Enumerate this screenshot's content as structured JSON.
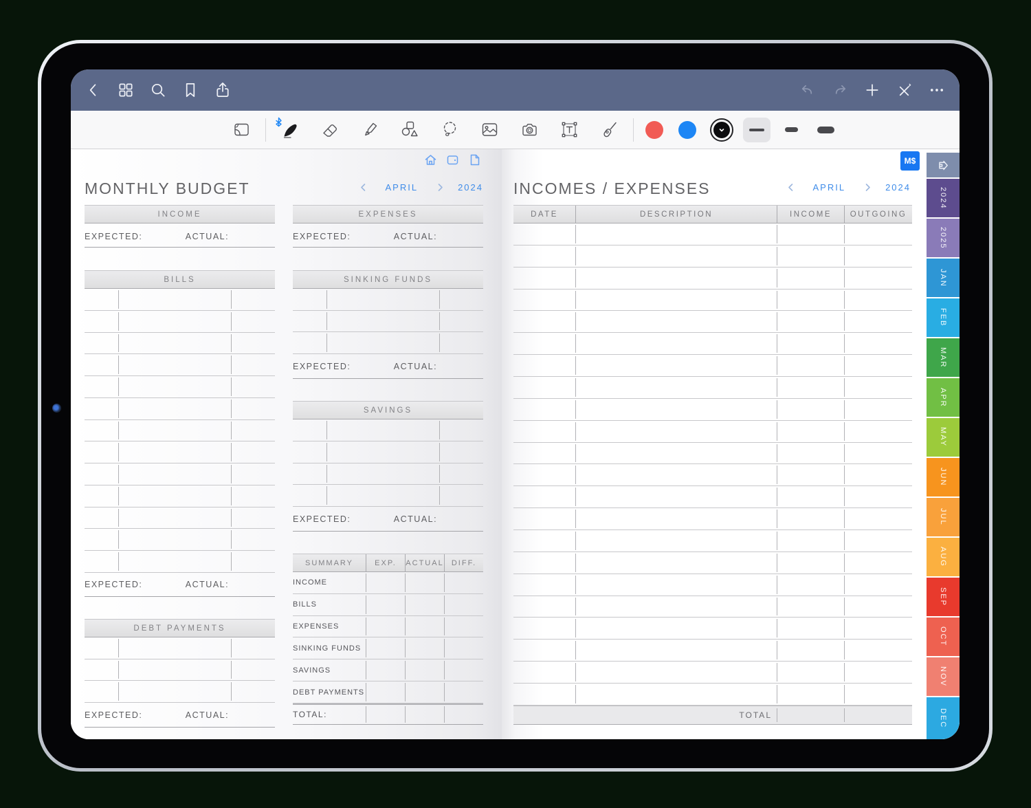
{
  "navbar": {
    "left_icons": [
      "back-icon",
      "grid-icon",
      "search-icon",
      "bookmark-icon",
      "share-icon"
    ],
    "right_icons": [
      "undo-icon",
      "redo-icon",
      "add-page-icon",
      "close-pen-icon",
      "more-icon"
    ]
  },
  "toolbar": {
    "tools": [
      "page-turn",
      "pen",
      "eraser",
      "highlighter",
      "shapes",
      "lasso",
      "image",
      "camera",
      "text-box",
      "laser-pointer"
    ],
    "selected_tool": "pen",
    "colors": [
      "#f15b55",
      "#1d86f5",
      "#0c0c0e"
    ],
    "selected_color": "#0c0c0e",
    "stroke_widths": [
      "thin",
      "medium",
      "thick"
    ],
    "selected_stroke": "thin"
  },
  "page_links": [
    "home-icon",
    "wallet-icon",
    "document-icon"
  ],
  "badge_label": "M$",
  "left_page": {
    "title": "MONTHLY BUDGET",
    "nav": {
      "month": "APRIL",
      "year": "2024"
    },
    "income": {
      "title": "INCOME",
      "expected_label": "EXPECTED:",
      "actual_label": "ACTUAL:"
    },
    "bills": {
      "title": "BILLS",
      "row_count": 13,
      "expected_label": "EXPECTED:",
      "actual_label": "ACTUAL:"
    },
    "debt_payments": {
      "title": "DEBT PAYMENTS",
      "row_count": 3,
      "expected_label": "EXPECTED:",
      "actual_label": "ACTUAL:"
    },
    "expenses": {
      "title": "EXPENSES",
      "expected_label": "EXPECTED:",
      "actual_label": "ACTUAL:"
    },
    "sinking_funds": {
      "title": "SINKING FUNDS",
      "row_count": 3,
      "expected_label": "EXPECTED:",
      "actual_label": "ACTUAL:"
    },
    "savings": {
      "title": "SAVINGS",
      "row_count": 4,
      "expected_label": "EXPECTED:",
      "actual_label": "ACTUAL:"
    },
    "summary": {
      "headers": [
        "SUMMARY",
        "EXP.",
        "ACTUAL",
        "DIFF."
      ],
      "rows": [
        "INCOME",
        "BILLS",
        "EXPENSES",
        "SINKING FUNDS",
        "SAVINGS",
        "DEBT PAYMENTS"
      ],
      "total_label": "TOTAL:"
    }
  },
  "right_page": {
    "title": "INCOMES / EXPENSES",
    "nav": {
      "month": "APRIL",
      "year": "2024"
    },
    "table": {
      "headers": [
        "DATE",
        "DESCRIPTION",
        "INCOME",
        "OUTGOING"
      ],
      "row_count": 22,
      "total_label": "TOTAL"
    }
  },
  "side_tabs": [
    {
      "label": "",
      "type": "home",
      "color": "#7e8dac"
    },
    {
      "label": "2024",
      "color": "#5d4c8e"
    },
    {
      "label": "2025",
      "color": "#8a7bb8"
    },
    {
      "label": "JAN",
      "color": "#2e96d5"
    },
    {
      "label": "FEB",
      "color": "#29ade3"
    },
    {
      "label": "MAR",
      "color": "#3fa64a"
    },
    {
      "label": "APR",
      "color": "#71bf44"
    },
    {
      "label": "MAY",
      "color": "#9ccb3b"
    },
    {
      "label": "JUN",
      "color": "#f7941e"
    },
    {
      "label": "JUL",
      "color": "#f9a13b"
    },
    {
      "label": "AUG",
      "color": "#fbb040"
    },
    {
      "label": "SEP",
      "color": "#e83a2d"
    },
    {
      "label": "OCT",
      "color": "#ee6150"
    },
    {
      "label": "NOV",
      "color": "#f08071"
    },
    {
      "label": "DEC",
      "color": "#2ca9e1"
    }
  ]
}
